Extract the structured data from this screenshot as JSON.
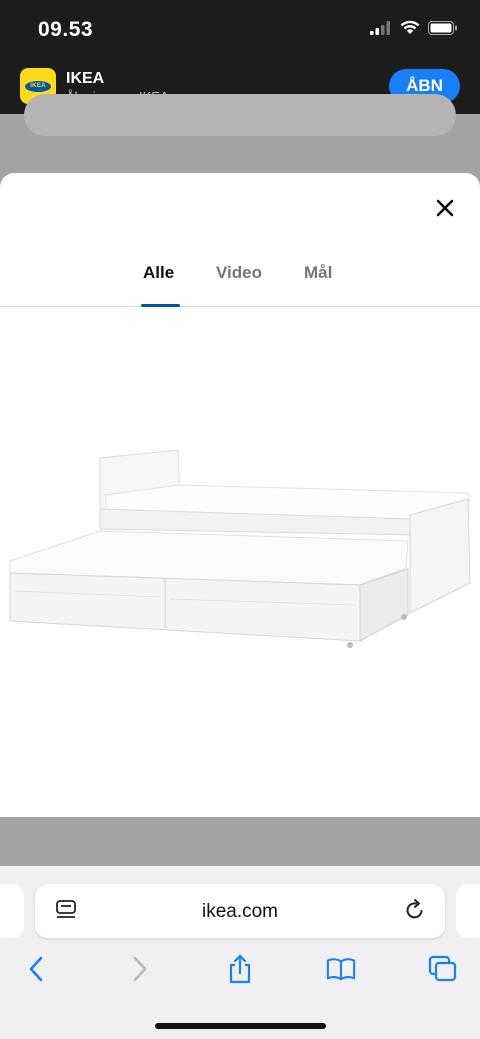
{
  "status_bar": {
    "time": "09.53"
  },
  "app_banner": {
    "name": "IKEA",
    "subtitle": "Åbn i appen IKEA",
    "open_label": "ÅBN",
    "logo_text": "IKEA"
  },
  "modal": {
    "tabs": [
      {
        "label": "Alle",
        "active": true
      },
      {
        "label": "Video",
        "active": false
      },
      {
        "label": "Mål",
        "active": false
      }
    ]
  },
  "browser": {
    "url": "ikea.com"
  },
  "colors": {
    "accent": "#0058a3",
    "brand_yellow": "#ffda1a",
    "ios_blue": "#1a7ef5"
  }
}
